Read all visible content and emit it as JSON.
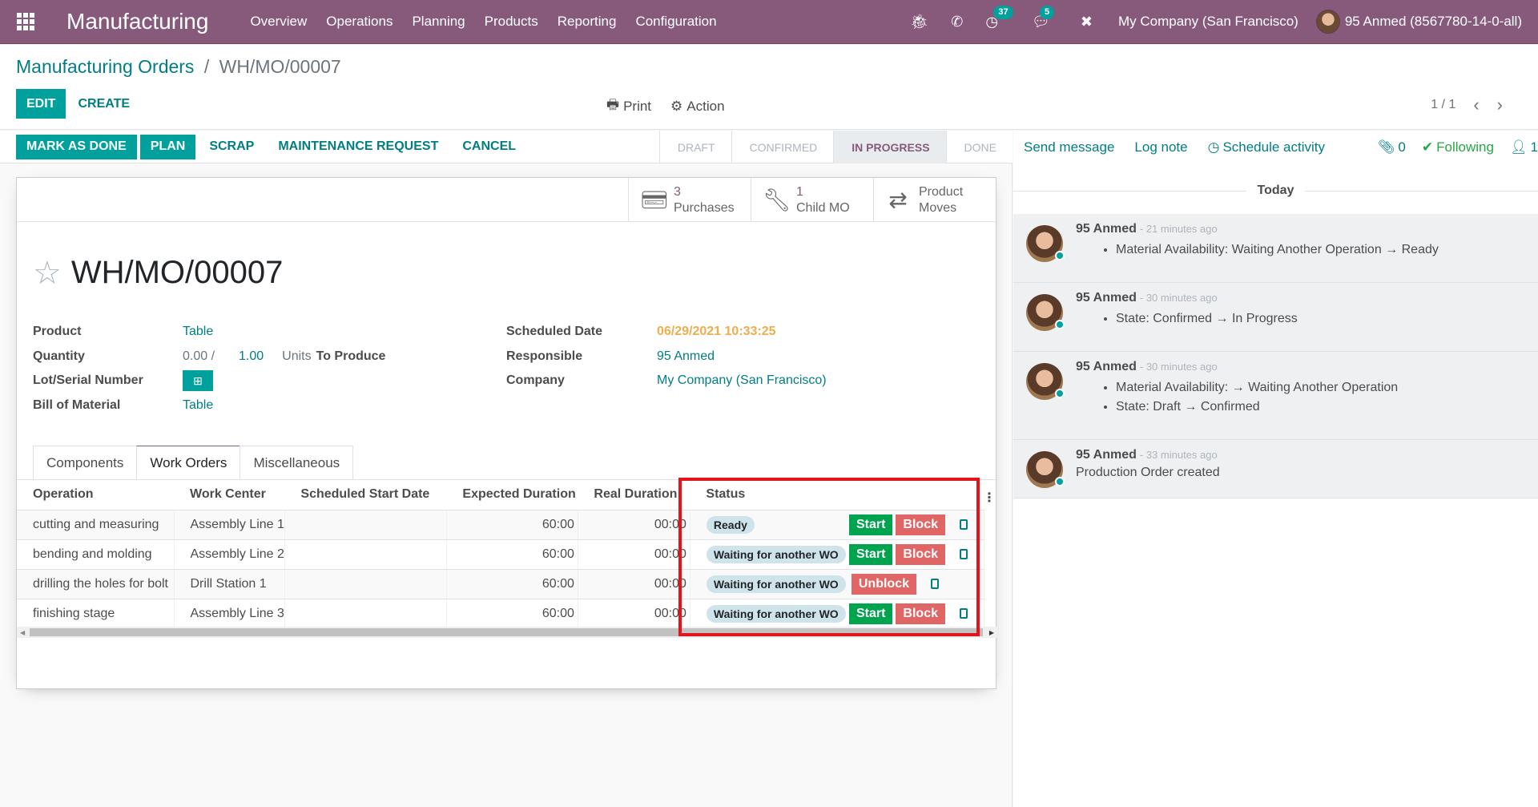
{
  "navbar": {
    "app_name": "Manufacturing",
    "menu": [
      "Overview",
      "Operations",
      "Planning",
      "Products",
      "Reporting",
      "Configuration"
    ],
    "activity_count": "37",
    "message_count": "5",
    "company": "My Company (San Francisco)",
    "user": "95 Anmed (8567780-14-0-all)",
    "icons": [
      "apps-icon",
      "bug-icon",
      "phone-icon",
      "activity-clock-icon",
      "chat-icon",
      "tools-icon"
    ]
  },
  "breadcrumb": {
    "parent": "Manufacturing Orders",
    "separator": "/",
    "current": "WH/MO/00007"
  },
  "control": {
    "edit_label": "EDIT",
    "create_label": "CREATE",
    "print_label": "Print",
    "action_label": "Action",
    "pager": "1 / 1"
  },
  "statusbar": {
    "buttons": [
      "MARK AS DONE",
      "PLAN",
      "SCRAP",
      "MAINTENANCE REQUEST",
      "CANCEL"
    ],
    "steps": [
      "DRAFT",
      "CONFIRMED",
      "IN PROGRESS",
      "DONE"
    ],
    "active_step": "IN PROGRESS"
  },
  "smart_buttons": [
    {
      "count": "3",
      "label": "Purchases",
      "icon": "credit-card-icon"
    },
    {
      "count": "1",
      "label": "Child MO",
      "icon": "wrench-icon"
    },
    {
      "count": "Product",
      "label": "Moves",
      "icon": "exchange-icon"
    }
  ],
  "record": {
    "title": "WH/MO/00007",
    "left_fields": {
      "product_label": "Product",
      "product_value": "Table",
      "quantity_label": "Quantity",
      "qty_produced": "0.00 /",
      "qty_target": "1.00",
      "uom": "Units",
      "to_produce": "To Produce",
      "lot_label": "Lot/Serial Number",
      "bom_label": "Bill of Material",
      "bom_value": "Table"
    },
    "right_fields": {
      "date_label": "Scheduled Date",
      "date_value": "06/29/2021 10:33:25",
      "responsible_label": "Responsible",
      "responsible_value": "95 Anmed",
      "company_label": "Company",
      "company_value": "My Company (San Francisco)"
    }
  },
  "tabs": [
    "Components",
    "Work Orders",
    "Miscellaneous"
  ],
  "active_tab": "Work Orders",
  "work_orders": {
    "columns": [
      "Operation",
      "Work Center",
      "Scheduled Start Date",
      "Expected Duration",
      "Real Duration",
      "Status"
    ],
    "rows": [
      {
        "operation": "cutting and measuring",
        "work_center": "Assembly Line 1",
        "start": "",
        "expected": "60:00",
        "real": "00:00",
        "status": "Ready",
        "actions": [
          "Start",
          "Block"
        ]
      },
      {
        "operation": "bending and molding",
        "work_center": "Assembly Line 2",
        "start": "",
        "expected": "60:00",
        "real": "00:00",
        "status": "Waiting for another WO",
        "actions": [
          "Start",
          "Block"
        ]
      },
      {
        "operation": "drilling the holes for bolt",
        "work_center": "Drill Station 1",
        "start": "",
        "expected": "60:00",
        "real": "00:00",
        "status": "Waiting for another WO",
        "actions": [
          "Unblock"
        ]
      },
      {
        "operation": "finishing stage",
        "work_center": "Assembly Line 3",
        "start": "",
        "expected": "60:00",
        "real": "00:00",
        "status": "Waiting for another WO",
        "actions": [
          "Start",
          "Block"
        ]
      }
    ]
  },
  "chatter": {
    "send_message": "Send message",
    "log_note": "Log note",
    "schedule_activity": "Schedule activity",
    "attachments": "0",
    "following": "Following",
    "followers": "1",
    "date_separator": "Today",
    "messages": [
      {
        "author": "95 Anmed",
        "date": "- 21 minutes ago",
        "items": [
          "Material Availability: Waiting Another Operation → Ready"
        ]
      },
      {
        "author": "95 Anmed",
        "date": "- 30 minutes ago",
        "items": [
          "State: Confirmed → In Progress"
        ]
      },
      {
        "author": "95 Anmed",
        "date": "- 30 minutes ago",
        "items": [
          "Material Availability: → Waiting Another Operation",
          "State: Draft → Confirmed"
        ]
      },
      {
        "author": "95 Anmed",
        "date": "- 33 minutes ago",
        "text": "Production Order created"
      }
    ]
  },
  "colors": {
    "brand": "#875a7b",
    "primary": "#00a09d",
    "link": "#017e84",
    "start": "#00a44f",
    "block": "#e06666",
    "warning_date": "#f0ad4e",
    "highlight": "#e3141c"
  }
}
